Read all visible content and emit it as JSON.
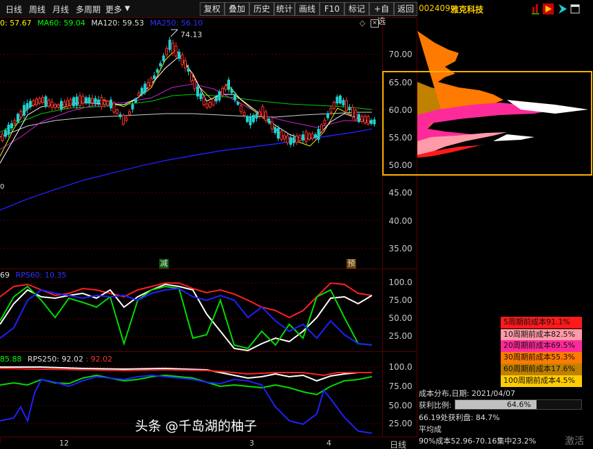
{
  "toolbar": {
    "period_day": "日线",
    "period_week": "周线",
    "period_month": "月线",
    "multi_period": "多周期",
    "more": "更多",
    "btn_restore": "复权",
    "btn_overlay": "叠加",
    "btn_history": "历史",
    "btn_stats": "统计",
    "btn_draw": "画线",
    "btn_f10": "F10",
    "btn_mark": "标记",
    "btn_add_fav": "+自选",
    "btn_back": "返回"
  },
  "stock": {
    "code": "002409",
    "name": "雅克科技"
  },
  "main_chart": {
    "ma_labels": [
      {
        "text": "0: 57.67",
        "color": "#ffff00"
      },
      {
        "text": "MA60: 59.04",
        "color": "#00ff00"
      },
      {
        "text": "MA120: 59.53",
        "color": "#e0e0e0"
      },
      {
        "text": "MA250: 56.10",
        "color": "#3030ff"
      }
    ],
    "high_label": "74.13",
    "left_label": "0",
    "marker_jian": "减",
    "marker_yu": "预",
    "y_ticks": [
      "70.00",
      "65.00",
      "60.00",
      "55.00",
      "50.00",
      "45.00",
      "40.00",
      "35.00"
    ]
  },
  "cost_panel": {
    "y_ticks": [
      "70.00",
      "65.00",
      "60.00",
      "55.00",
      "50.00"
    ]
  },
  "rps_panel1": {
    "labels": [
      {
        "text": "69",
        "color": "#e0e0e0"
      },
      {
        "text": "RPS60: 10.35",
        "color": "#3030ff"
      }
    ],
    "y_ticks": [
      "100.0",
      "75.00",
      "50.00",
      "25.00"
    ]
  },
  "rps_panel2": {
    "labels": [
      {
        "text": "85.88",
        "color": "#00ff00"
      },
      {
        "text": "RPS250: 92.02",
        "color": "#e0e0e0"
      },
      {
        "text": ": 92.02",
        "color": "#ff3030"
      }
    ],
    "y_ticks": [
      "100.0",
      "75.00",
      "50.00",
      "25.00"
    ]
  },
  "x_axis": {
    "labels": [
      "12",
      "3",
      "4"
    ],
    "period": "日线"
  },
  "legend": [
    {
      "text": "5周期前成本91.1%",
      "color": "#ff1a1a"
    },
    {
      "text": "10周期前成本82.5%",
      "color": "#ff9aa8"
    },
    {
      "text": "20周期前成本69.5%",
      "color": "#ff2a9a"
    },
    {
      "text": "30周期前成本55.3%",
      "color": "#ff7a00"
    },
    {
      "text": "60周期前成本17.6%",
      "color": "#c08000"
    },
    {
      "text": "100周期前成本4.5%",
      "color": "#ffcc00"
    }
  ],
  "cost_info": {
    "date_line": "成本分布,日期:  2021/04/07",
    "profit_label": "获利比例:",
    "profit_value": "64.6%",
    "profit_fraction": 0.646,
    "line2": "66.19处获利盘:  84.7%",
    "line3": "平均成",
    "line4": "90%成本52.96-70.16集中23.2%"
  },
  "watermark": {
    "text": "头条 @千岛湖的柚子",
    "activate": "激活"
  },
  "colors": {
    "accent_red": "#ff0000",
    "highlight_box": "#ffb000",
    "ma250": "#2020ff",
    "ma60": "#00cc00"
  }
}
